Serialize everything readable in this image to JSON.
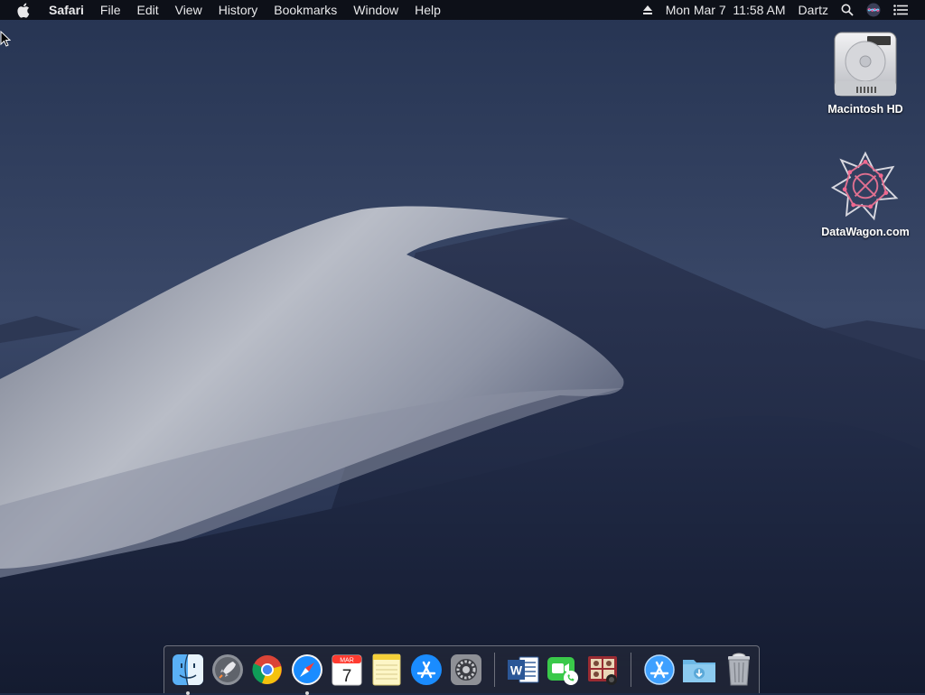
{
  "menubar": {
    "app_name": "Safari",
    "menus": [
      "File",
      "Edit",
      "View",
      "History",
      "Bookmarks",
      "Window",
      "Help"
    ],
    "clock": "Mon Mar 7  11:58 AM",
    "user": "Dartz"
  },
  "desktop": {
    "icons": [
      {
        "label": "Macintosh HD",
        "icon": "hard-drive-icon"
      },
      {
        "label": "DataWagon.com",
        "icon": "datawagon-icon"
      }
    ]
  },
  "dock": {
    "calendar_month": "MAR",
    "calendar_day": "7",
    "word_letter": "W",
    "items": [
      {
        "name": "finder",
        "running": true
      },
      {
        "name": "launchpad",
        "running": false
      },
      {
        "name": "chrome",
        "running": false
      },
      {
        "name": "safari",
        "running": true
      },
      {
        "name": "calendar",
        "running": false
      },
      {
        "name": "notes",
        "running": false
      },
      {
        "name": "app-store",
        "running": false
      },
      {
        "name": "system-preferences",
        "running": false
      },
      {
        "name": "microsoft-word",
        "running": false
      },
      {
        "name": "facetime",
        "running": false
      },
      {
        "name": "photo-booth",
        "running": false
      },
      {
        "name": "applications-folder",
        "running": false
      },
      {
        "name": "downloads-folder",
        "running": false
      },
      {
        "name": "trash",
        "running": false
      }
    ]
  },
  "colors": {
    "menubar_bg": "#0c0e14",
    "sky": "#1c2a46",
    "dune_light": "#b8bcc6",
    "safari_blue": "#1a8cff",
    "word_blue": "#2b5797",
    "facetime_green": "#3ac94a"
  }
}
